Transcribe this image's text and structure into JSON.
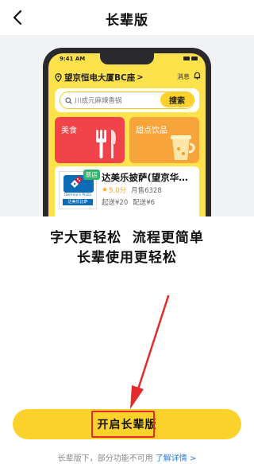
{
  "header": {
    "title": "长辈版",
    "back_icon": "back-arrow-icon"
  },
  "phone_preview": {
    "status_time": "9:41 AM",
    "location": "望京恒电大厦BC座",
    "location_chevron": ">",
    "message_label": "消息",
    "search": {
      "placeholder": "川成元麻辣香锅",
      "button_label": "搜索"
    },
    "categories": [
      {
        "label": "美食",
        "color": "#f0444a"
      },
      {
        "label": "甜点饮品",
        "color": "#f7a43b"
      }
    ],
    "store": {
      "badge": "新店",
      "name": "达美乐披萨(望京华…",
      "logo_text_en": "Domino's Pizza",
      "logo_text_cn": "达美乐比萨",
      "rating": "5.0分",
      "sales": "月售6328",
      "min_order": "起送¥20",
      "delivery_fee": "配送¥6"
    }
  },
  "headline": {
    "line1": "字大更轻松  流程更简单",
    "line2": "长辈使用更轻松"
  },
  "cta": {
    "label": "开启长辈版",
    "color": "#fbd22c"
  },
  "footer": {
    "note": "长辈版下，部分功能不可用",
    "link_label": "了解详情 >"
  },
  "annotation_color": "#e32b2b"
}
